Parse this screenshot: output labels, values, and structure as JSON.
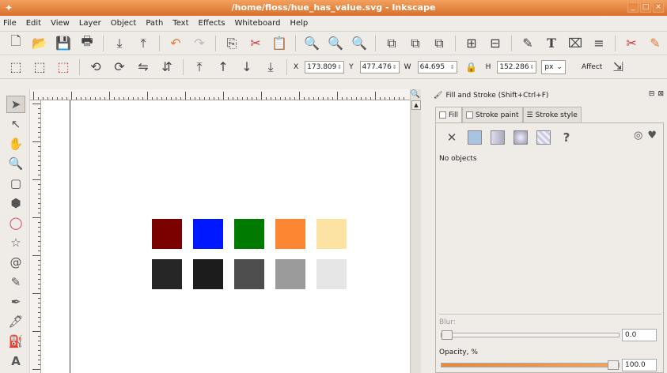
{
  "window": {
    "title": "/home/floss/hue_has_value.svg - Inkscape",
    "buttons": [
      "_",
      "□",
      "×"
    ]
  },
  "menubar": {
    "items": [
      "File",
      "Edit",
      "View",
      "Layer",
      "Object",
      "Path",
      "Text",
      "Effects",
      "Whiteboard",
      "Help"
    ]
  },
  "toolbar_controls": {
    "x_label": "X",
    "x_value": "173.809",
    "y_label": "Y",
    "y_value": "477.476",
    "w_label": "W",
    "w_value": "64.695",
    "h_label": "H",
    "h_value": "152.286",
    "unit": "px",
    "affect_label": "Affect"
  },
  "canvas": {
    "swatches": [
      {
        "color": "#7b0000"
      },
      {
        "color": "#0018ff"
      },
      {
        "color": "#007b00"
      },
      {
        "color": "#fd8632"
      },
      {
        "color": "#fde3a3"
      },
      {
        "color": "#262626"
      },
      {
        "color": "#1c1c1c"
      },
      {
        "color": "#4e4e4e"
      },
      {
        "color": "#9b9b9b"
      },
      {
        "color": "#e6e6e6"
      }
    ]
  },
  "dock": {
    "title": "Fill and Stroke (Shift+Ctrl+F)",
    "tabs": [
      "Fill",
      "Stroke paint",
      "Stroke style"
    ],
    "no_objects": "No objects",
    "blur_label": "Blur:",
    "blur_value": "0.0",
    "opacity_label": "Opacity, %",
    "opacity_value": "100.0",
    "opacity_fraction": 1.0
  },
  "colors": {
    "titlebar": "#e07b3a",
    "accent": "#f0a05a"
  }
}
